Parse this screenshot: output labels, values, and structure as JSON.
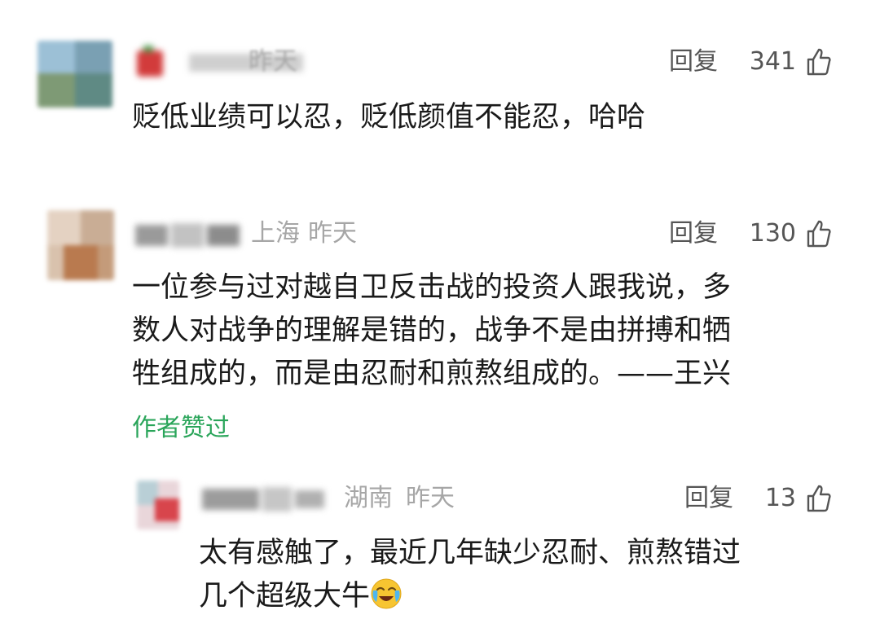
{
  "comments": [
    {
      "location": "",
      "time": "昨天",
      "reply_label": "回复",
      "likes": "341",
      "lines": [
        "贬低业绩可以忍，贬低颜值不能忍，哈哈"
      ]
    },
    {
      "location": "上海",
      "time": "昨天",
      "reply_label": "回复",
      "likes": "130",
      "lines": [
        "一位参与过对越自卫反击战的投资人跟我说，多",
        "数人对战争的理解是错的，战争不是由拼搏和牺",
        "牲组成的，而是由忍耐和煎熬组成的。——王兴"
      ],
      "author_liked": "作者赞过"
    }
  ],
  "reply": {
    "location": "湖南",
    "time": "昨天",
    "reply_label": "回复",
    "likes": "13",
    "lines": [
      "太有感触了，最近几年缺少忍耐、煎熬错过",
      "几个超级大牛"
    ],
    "emoji_icon": "crying-face-emoji"
  },
  "colors": {
    "author_liked": "#2aa55a",
    "meta": "#a6a6a6",
    "text": "#1a1a1a"
  }
}
